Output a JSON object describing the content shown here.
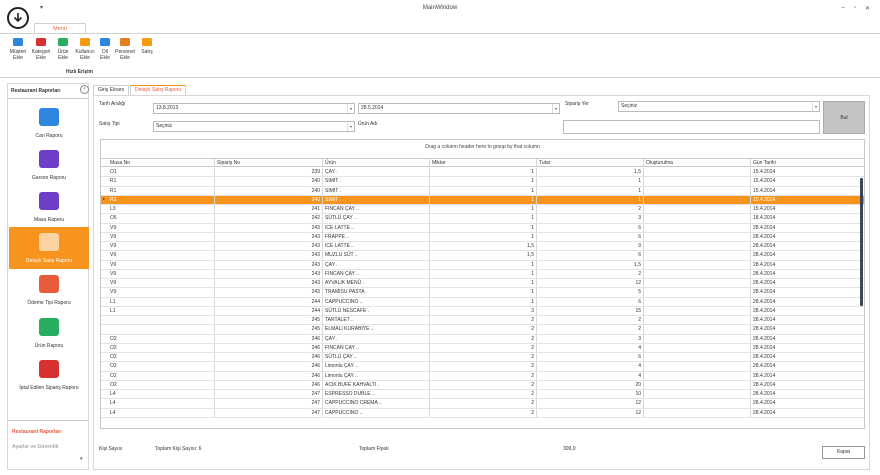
{
  "window": {
    "title": "MainWindow",
    "min": "–",
    "max": "▫",
    "close": "✕"
  },
  "ribbon": {
    "tab": "Menü",
    "group_label": "Hızlı Erişim",
    "buttons": [
      {
        "line1": "Müşteri",
        "line2": "Ekle",
        "icon": "customer-add-icon",
        "color": "#2e86de"
      },
      {
        "line1": "Kategori",
        "line2": "Ekle",
        "icon": "category-add-icon",
        "color": "#d63031"
      },
      {
        "line1": "Ürün",
        "line2": "Ekle",
        "icon": "product-add-icon",
        "color": "#27ae60"
      },
      {
        "line1": "Kullanıcı",
        "line2": "Ekle",
        "icon": "user-add-icon",
        "color": "#f39c12"
      },
      {
        "line1": "Dil",
        "line2": "Ekle",
        "icon": "language-add-icon",
        "color": "#2e86de"
      },
      {
        "line1": "Personel",
        "line2": "Ekle",
        "icon": "staff-add-icon",
        "color": "#e67e22"
      },
      {
        "line1": "Satış",
        "line2": "",
        "icon": "sales-icon",
        "color": "#f39c12"
      }
    ]
  },
  "sidebar": {
    "header": "Restaurant Raporları",
    "items": [
      {
        "label": "Cari Raporu",
        "icon": "id-card-icon"
      },
      {
        "label": "Garson Raporu",
        "icon": "chef-icon"
      },
      {
        "label": "Masa Raporu",
        "icon": "clipboard-icon"
      },
      {
        "label": "Detaylı Satış Raporu",
        "icon": "chart-icon"
      },
      {
        "label": "Ödeme Tipi Raporu",
        "icon": "credit-card-icon"
      },
      {
        "label": "Ürün Raporu",
        "icon": "cart-icon"
      },
      {
        "label": "İptal Edilen Sipariş Raporu",
        "icon": "cancel-list-icon"
      }
    ],
    "footer_active": "Restaurant Raporları",
    "footer_other": "Ayarlar ve Güvenlik",
    "footer_arrow": "▾"
  },
  "tabs": [
    "Giriş Ekranı",
    "Detaylı Satış Raporu"
  ],
  "filters": {
    "date_label": "Tarih Aralığı",
    "date_start": "13.8.2013",
    "date_end": "28.5.2014",
    "order_place_label": "Sipariş Yer",
    "order_place_value": "Seçiniz",
    "sales_type_label": "Satış Tipi",
    "sales_type_value": "Seçiniz",
    "product_name_label": "Ürün Adı",
    "search_button": "Bul"
  },
  "grid": {
    "group_hint": "Drag a column header here to group by that column",
    "columns": [
      "Masa No",
      "Sipariş No",
      "Ürün",
      "Miktar",
      "Tutar",
      "Oluşturulma",
      "Gün Tarihi"
    ],
    "rows": [
      [
        "O1",
        "239",
        "ÇAY .",
        "1",
        "1,5",
        "",
        "15.4.2014"
      ],
      [
        "R1",
        "240",
        "SIMIT .",
        "1",
        "1",
        "",
        "15.4.2014"
      ],
      [
        "R1",
        "240",
        "SIMIT .",
        "1",
        "1",
        "",
        "15.4.2014"
      ],
      [
        "R1",
        "240",
        "SIMIT .",
        "1",
        "1",
        "",
        "15.4.2014"
      ],
      [
        "L3",
        "241",
        "FINCAN ÇAY ..",
        "1",
        "2",
        "",
        "15.4.2014"
      ],
      [
        "O5",
        "242",
        "SÜTLÜ ÇAY ..",
        "1",
        "3",
        "",
        "18.4.2014"
      ],
      [
        "V9",
        "243",
        "ICE LATTE ..",
        "1",
        "6",
        "",
        "28.4.2014"
      ],
      [
        "V9",
        "243",
        "FRAPPE ..",
        "1",
        "6",
        "",
        "28.4.2014"
      ],
      [
        "V9",
        "243",
        "ICE LATTE ..",
        "1,5",
        "9",
        "",
        "28.4.2014"
      ],
      [
        "V9",
        "243",
        "MUZLU SÜT ..",
        "1,5",
        "6",
        "",
        "28.4.2014"
      ],
      [
        "V9",
        "243",
        "ÇAY .",
        "1",
        "1,5",
        "",
        "28.4.2014"
      ],
      [
        "V9",
        "243",
        "FINCAN ÇAY ..",
        "1",
        "2",
        "",
        "28.4.2014"
      ],
      [
        "V9",
        "243",
        "AYVALIK MENÜ .",
        "1",
        "12",
        "",
        "28.4.2014"
      ],
      [
        "V9",
        "243",
        "TRAMISU PASTA .",
        "1",
        "5",
        "",
        "28.4.2014"
      ],
      [
        "L1",
        "244",
        "CAPPUCCINO ..",
        "1",
        "6",
        "",
        "28.4.2014"
      ],
      [
        "L1",
        "244",
        "SÜTLÜ NESCAFE .",
        "3",
        "15",
        "",
        "28.4.2014"
      ],
      [
        "",
        "245",
        "TARTALET ..",
        "2",
        "2",
        "",
        "28.4.2014"
      ],
      [
        "",
        "245",
        "ELMALI KURABIYE ..",
        "2",
        "2",
        "",
        "28.4.2014"
      ],
      [
        "O2",
        "246",
        "ÇAY .",
        "2",
        "3",
        "",
        "28.4.2014"
      ],
      [
        "O2",
        "246",
        "FINCAN ÇAY ..",
        "2",
        "4",
        "",
        "28.4.2014"
      ],
      [
        "O2",
        "246",
        "SÜTLÜ ÇAY ..",
        "2",
        "6",
        "",
        "28.4.2014"
      ],
      [
        "O2",
        "246",
        "Limonlu ÇAY ..",
        "2",
        "4",
        "",
        "28.4.2014"
      ],
      [
        "O2",
        "246",
        "Limonlu ÇAY ..",
        "2",
        "4",
        "",
        "28.4.2014"
      ],
      [
        "O2",
        "246",
        "ACIK BUFE KAHVALTI .",
        "2",
        "20",
        "",
        "28.4.2014"
      ],
      [
        "L4",
        "247",
        "ESPRESSO DUBLE ..",
        "2",
        "10",
        "",
        "28.4.2014"
      ],
      [
        "L4",
        "247",
        "CAPPUCCINO CREMA ..",
        "2",
        "12",
        "",
        "28.4.2014"
      ],
      [
        "L4",
        "247",
        "CAPPUCCINO ..",
        "2",
        "12",
        "",
        "28.4.2014"
      ]
    ],
    "selected_index": 3,
    "row_indicator": "▸"
  },
  "footer": {
    "guest_count_label": "Kişi Sayısı",
    "total_guests": "Toplam Kişi Sayısı: 6",
    "total_price_label": "Toplam Fiyatı",
    "total_price_value": "309,0",
    "close_button": "Kapat"
  },
  "colors": {
    "accent": "#f7941d",
    "tab_text": "#e85b3a"
  }
}
